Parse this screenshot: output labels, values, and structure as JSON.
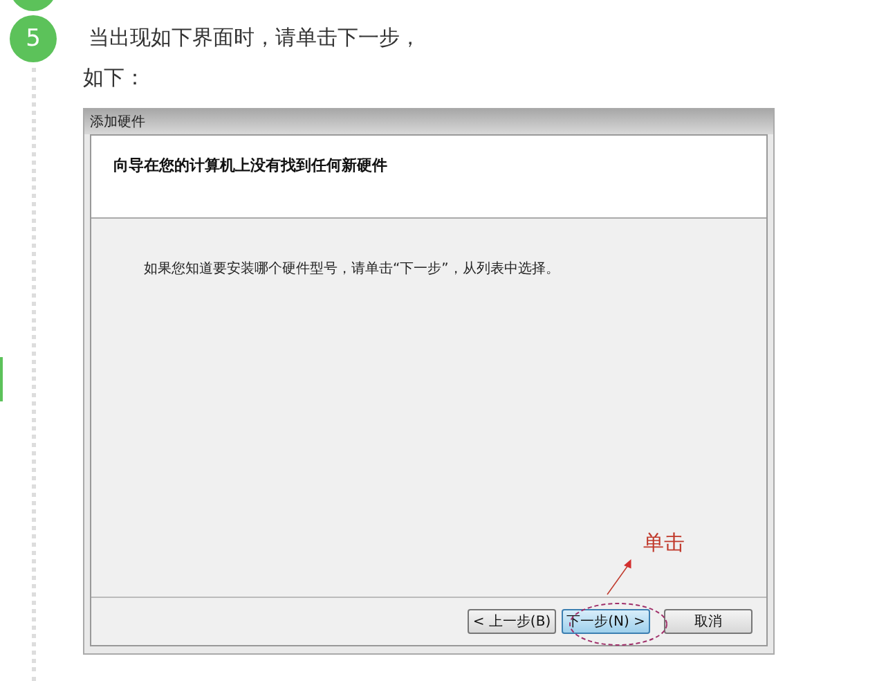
{
  "step": {
    "number": "5",
    "instruction": "当出现如下界面时，请单击下一步，",
    "followup": "如下："
  },
  "dialog": {
    "title": "添加硬件",
    "heading": "向导在您的计算机上没有找到任何新硬件",
    "body": "如果您知道要安装哪个硬件型号，请单击“下一步”，从列表中选择。",
    "buttons": [
      {
        "label": "< 上一步(B)",
        "selected": false
      },
      {
        "label": "下一步(N) >",
        "selected": true
      },
      {
        "label": "取消",
        "selected": false
      }
    ]
  },
  "annotation": {
    "label": "单击"
  }
}
